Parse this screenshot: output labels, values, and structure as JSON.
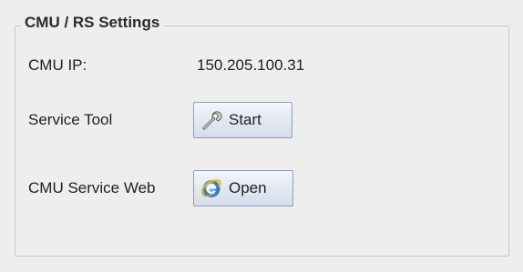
{
  "group": {
    "title": "CMU / RS Settings"
  },
  "rows": {
    "cmu_ip": {
      "label": "CMU IP:",
      "value": "150.205.100.31"
    },
    "service_tool": {
      "label": "Service Tool",
      "button_label": "Start",
      "button_icon": "wrench-icon"
    },
    "service_web": {
      "label": "CMU Service Web",
      "button_label": "Open",
      "button_icon": "internet-explorer-icon"
    }
  },
  "colors": {
    "panel_background": "#eeeeee",
    "border": "#c9c9c9",
    "button_border": "#8d9fb8",
    "text": "#222222"
  }
}
